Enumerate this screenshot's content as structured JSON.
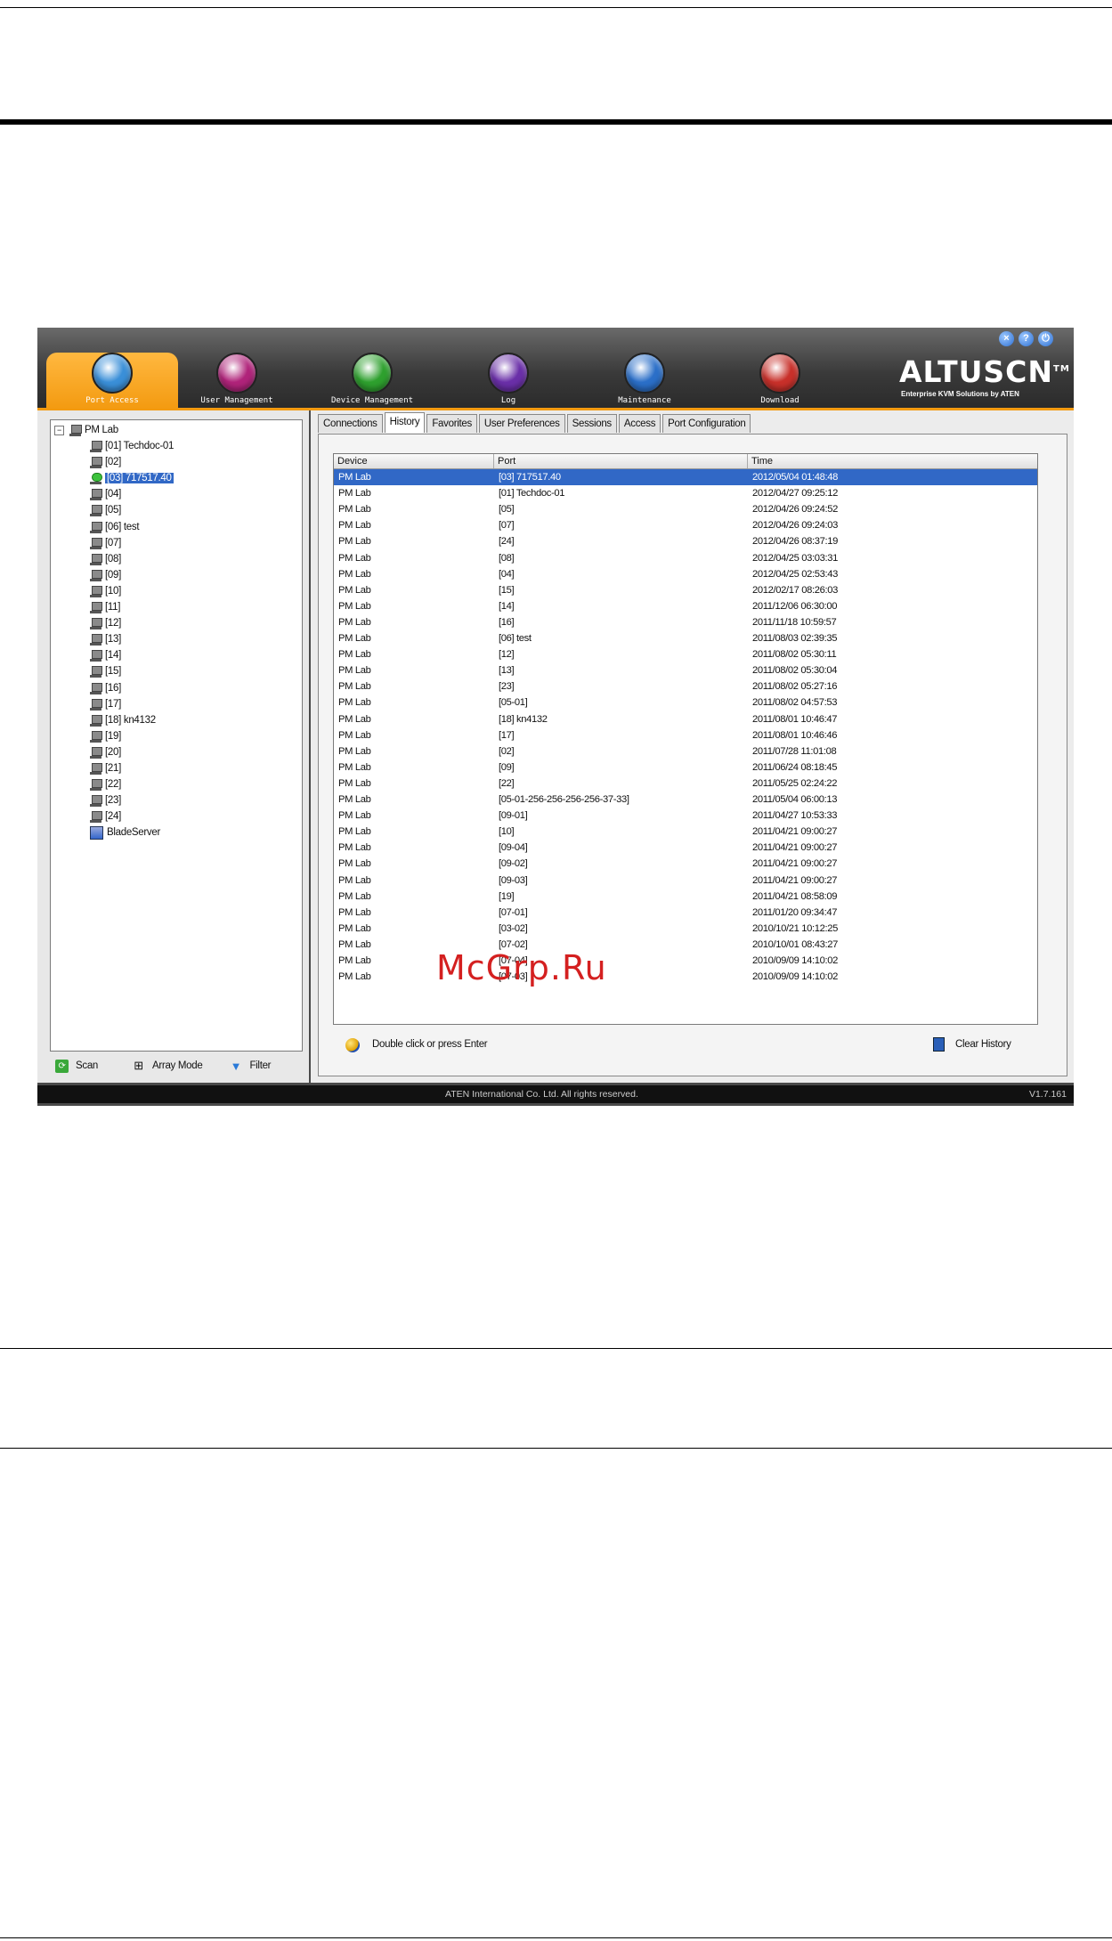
{
  "window": {
    "logo": "ALTUSCN",
    "logo_tm": "TM",
    "tagline": "Enterprise KVM Solutions by ATEN",
    "copyright": "ATEN International Co. Ltd. All rights reserved.",
    "version": "V1.7.161"
  },
  "nav": [
    {
      "label": "Port Access",
      "icon": "monitor-icon",
      "color": "#3a8fd8"
    },
    {
      "label": "User Management",
      "icon": "users-icon",
      "color": "#b0237a"
    },
    {
      "label": "Device Management",
      "icon": "gear-icon",
      "color": "#2ea02e"
    },
    {
      "label": "Log",
      "icon": "log-icon",
      "color": "#6a2fa8"
    },
    {
      "label": "Maintenance",
      "icon": "wrench-icon",
      "color": "#2b6fc8"
    },
    {
      "label": "Download",
      "icon": "download-icon",
      "color": "#c8302a"
    }
  ],
  "tree": {
    "root": "PM Lab",
    "items": [
      "[01] Techdoc-01",
      "[02]",
      "[03] 717517.40",
      "[04]",
      "[05]",
      "[06] test",
      "[07]",
      "[08]",
      "[09]",
      "[10]",
      "[11]",
      "[12]",
      "[13]",
      "[14]",
      "[15]",
      "[16]",
      "[17]",
      "[18] kn4132",
      "[19]",
      "[20]",
      "[21]",
      "[22]",
      "[23]",
      "[24]"
    ],
    "blade": "BladeServer"
  },
  "left_toolbar": {
    "scan": "Scan",
    "array": "Array Mode",
    "filter": "Filter"
  },
  "tabs": [
    "Connections",
    "History",
    "Favorites",
    "User Preferences",
    "Sessions",
    "Access",
    "Port Configuration"
  ],
  "history": {
    "columns": [
      "Device",
      "Port",
      "Time"
    ],
    "rows": [
      [
        "PM Lab",
        "[03] 717517.40",
        "2012/05/04 01:48:48"
      ],
      [
        "PM Lab",
        "[01] Techdoc-01",
        "2012/04/27 09:25:12"
      ],
      [
        "PM Lab",
        "[05]",
        "2012/04/26 09:24:52"
      ],
      [
        "PM Lab",
        "[07]",
        "2012/04/26 09:24:03"
      ],
      [
        "PM Lab",
        "[24]",
        "2012/04/26 08:37:19"
      ],
      [
        "PM Lab",
        "[08]",
        "2012/04/25 03:03:31"
      ],
      [
        "PM Lab",
        "[04]",
        "2012/04/25 02:53:43"
      ],
      [
        "PM Lab",
        "[15]",
        "2012/02/17 08:26:03"
      ],
      [
        "PM Lab",
        "[14]",
        "2011/12/06 06:30:00"
      ],
      [
        "PM Lab",
        "[16]",
        "2011/11/18 10:59:57"
      ],
      [
        "PM Lab",
        "[06] test",
        "2011/08/03 02:39:35"
      ],
      [
        "PM Lab",
        "[12]",
        "2011/08/02 05:30:11"
      ],
      [
        "PM Lab",
        "[13]",
        "2011/08/02 05:30:04"
      ],
      [
        "PM Lab",
        "[23]",
        "2011/08/02 05:27:16"
      ],
      [
        "PM Lab",
        "[05-01]",
        "2011/08/02 04:57:53"
      ],
      [
        "PM Lab",
        "[18] kn4132",
        "2011/08/01 10:46:47"
      ],
      [
        "PM Lab",
        "[17]",
        "2011/08/01 10:46:46"
      ],
      [
        "PM Lab",
        "[02]",
        "2011/07/28 11:01:08"
      ],
      [
        "PM Lab",
        "[09]",
        "2011/06/24 08:18:45"
      ],
      [
        "PM Lab",
        "[22]",
        "2011/05/25 02:24:22"
      ],
      [
        "PM Lab",
        "[05-01-256-256-256-256-37-33]",
        "2011/05/04 06:00:13"
      ],
      [
        "PM Lab",
        "[09-01]",
        "2011/04/27 10:53:33"
      ],
      [
        "PM Lab",
        "[10]",
        "2011/04/21 09:00:27"
      ],
      [
        "PM Lab",
        "[09-04]",
        "2011/04/21 09:00:27"
      ],
      [
        "PM Lab",
        "[09-02]",
        "2011/04/21 09:00:27"
      ],
      [
        "PM Lab",
        "[09-03]",
        "2011/04/21 09:00:27"
      ],
      [
        "PM Lab",
        "[19]",
        "2011/04/21 08:58:09"
      ],
      [
        "PM Lab",
        "[07-01]",
        "2011/01/20 09:34:47"
      ],
      [
        "PM Lab",
        "[03-02]",
        "2010/10/21 10:12:25"
      ],
      [
        "PM Lab",
        "[07-02]",
        "2010/10/01 08:43:27"
      ],
      [
        "PM Lab",
        "[07-04]",
        "2010/09/09 14:10:02"
      ],
      [
        "PM Lab",
        "[07-03]",
        "2010/09/09 14:10:02"
      ]
    ]
  },
  "footer": {
    "hint": "Double click or press Enter",
    "clear": "Clear History"
  },
  "watermark": "McGrp.Ru"
}
